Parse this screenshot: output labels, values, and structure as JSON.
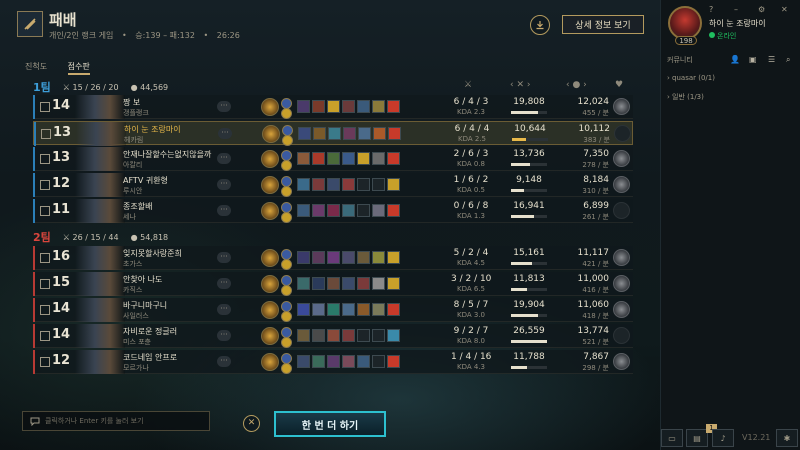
{
  "header": {
    "title": "패배",
    "mode": "개인/2인 랭크 게임",
    "lp": "승:139 – 패:132",
    "duration": "26:26",
    "detail_button": "상세 정보 보기"
  },
  "tabs": [
    {
      "label": "진척도",
      "active": false
    },
    {
      "label": "점수판",
      "active": true
    }
  ],
  "teams": [
    {
      "name": "1팀",
      "kda": "15 / 26 / 20",
      "gold": "44,569",
      "color": "#3d9ed9",
      "players": [
        {
          "level": "14",
          "name": "짱 보",
          "champion": "갱플랭크",
          "kda": "6 / 4 / 3",
          "kda_ratio": "KDA 2.3",
          "damage": "19,808",
          "damage_pct": 0.75,
          "gold": "12,024",
          "gold_per": "455 / 분",
          "self": false,
          "badge": true,
          "items": [
            "#4a3a6a",
            "#7a3a2a",
            "#c8a02a",
            "#6a3a3a",
            "#3a5a7a",
            "#8a7a3a",
            "#c83a2a"
          ]
        },
        {
          "level": "13",
          "name": "하이 눈 조랑마이",
          "champion": "헤카림",
          "kda": "6 / 4 / 4",
          "kda_ratio": "KDA 2.5",
          "damage": "10,644",
          "damage_pct": 0.4,
          "gold": "10,112",
          "gold_per": "383 / 분",
          "self": true,
          "badge": false,
          "items": [
            "#3a4a7a",
            "#7a5a2a",
            "#3a7a8a",
            "#6a3a5a",
            "#4a6a8a",
            "#aa5a2a",
            "#c83a2a"
          ]
        },
        {
          "level": "13",
          "name": "안재나잘할수는없지않을까",
          "champion": "아칼리",
          "kda": "2 / 6 / 3",
          "kda_ratio": "KDA 0.8",
          "damage": "13,736",
          "damage_pct": 0.52,
          "gold": "7,350",
          "gold_per": "278 / 분",
          "self": false,
          "badge": true,
          "items": [
            "#8a5a3a",
            "#aa3a2a",
            "#4a6a3a",
            "#3a5a8a",
            "#c8a02a",
            "#6a6a6a",
            "#c83a2a"
          ]
        },
        {
          "level": "12",
          "name": "AFTV 귀환형",
          "champion": "루시안",
          "kda": "1 / 6 / 2",
          "kda_ratio": "KDA 0.5",
          "damage": "9,148",
          "damage_pct": 0.35,
          "gold": "8,184",
          "gold_per": "310 / 분",
          "self": false,
          "badge": true,
          "items": [
            "#3a6a8a",
            "#7a3a3a",
            "#3a4a6a",
            "#8a3a3a",
            "#1c2428",
            "#1c2428",
            "#c8a02a"
          ]
        },
        {
          "level": "11",
          "name": "종조할배",
          "champion": "세나",
          "kda": "0 / 6 / 8",
          "kda_ratio": "KDA 1.3",
          "damage": "16,941",
          "damage_pct": 0.64,
          "gold": "6,899",
          "gold_per": "261 / 분",
          "self": false,
          "badge": false,
          "items": [
            "#3a5a7a",
            "#6a3a6a",
            "#7a2a4a",
            "#3a6a7a",
            "#1c2428",
            "#6a6a7a",
            "#c83a2a"
          ]
        }
      ]
    },
    {
      "name": "2팀",
      "kda": "26 / 15 / 44",
      "gold": "54,818",
      "color": "#d9453d",
      "players": [
        {
          "level": "16",
          "name": "잊지못할사랑준희",
          "champion": "초가스",
          "kda": "5 / 2 / 4",
          "kda_ratio": "KDA 4.5",
          "damage": "15,161",
          "damage_pct": 0.57,
          "gold": "11,117",
          "gold_per": "421 / 분",
          "self": false,
          "badge": true,
          "items": [
            "#3a3a6a",
            "#5a3a5a",
            "#6a3a7a",
            "#4a4a6a",
            "#6a5a3a",
            "#8a8a3a",
            "#c8a02a"
          ]
        },
        {
          "level": "15",
          "name": "안찾아 나도",
          "champion": "카직스",
          "kda": "3 / 2 / 10",
          "kda_ratio": "KDA 6.5",
          "damage": "11,813",
          "damage_pct": 0.45,
          "gold": "11,000",
          "gold_per": "416 / 분",
          "self": false,
          "badge": true,
          "items": [
            "#3a6a6a",
            "#2a3a5a",
            "#6a4a3a",
            "#3a4a6a",
            "#7a3a3a",
            "#8a8a8a",
            "#c8a02a"
          ]
        },
        {
          "level": "14",
          "name": "바구니마구니",
          "champion": "사일러스",
          "kda": "8 / 5 / 7",
          "kda_ratio": "KDA 3.0",
          "damage": "19,904",
          "damage_pct": 0.75,
          "gold": "11,060",
          "gold_per": "418 / 분",
          "self": false,
          "badge": true,
          "items": [
            "#3a4a9a",
            "#5a6a8a",
            "#2a7a6a",
            "#4a6a8a",
            "#8a5a2a",
            "#7a7a5a",
            "#c83a2a"
          ]
        },
        {
          "level": "14",
          "name": "자비로운 정글러",
          "champion": "미스 포츈",
          "kda": "9 / 2 / 7",
          "kda_ratio": "KDA 8.0",
          "damage": "26,559",
          "damage_pct": 1.0,
          "gold": "13,774",
          "gold_per": "521 / 분",
          "self": false,
          "badge": false,
          "items": [
            "#6a5a3a",
            "#4a4a4a",
            "#8a4a3a",
            "#7a3a3a",
            "#1c2428",
            "#1c2428",
            "#3a8aaa"
          ]
        },
        {
          "level": "12",
          "name": "코드네임 안프로",
          "champion": "모르가나",
          "kda": "1 / 4 / 16",
          "kda_ratio": "KDA 4.3",
          "damage": "11,788",
          "damage_pct": 0.44,
          "gold": "7,867",
          "gold_per": "298 / 분",
          "self": false,
          "badge": true,
          "items": [
            "#3a4a6a",
            "#3a6a5a",
            "#5a3a6a",
            "#7a4a5a",
            "#3a5a7a",
            "#1c2428",
            "#c83a2a"
          ]
        }
      ]
    }
  ],
  "chat": {
    "placeholder": "클릭하거나 Enter 키를 눌러 보기"
  },
  "play_again": "한 번 더 하기",
  "sidebar": {
    "summoner_name": "하이 눈 조랑마이",
    "status": "온라인",
    "level": "198",
    "community_title": "커뮤니티",
    "groups": [
      {
        "label": "quasar (0/1)"
      },
      {
        "label": "일반 (1/3)"
      }
    ],
    "version": "V12.21",
    "notification_count": "1"
  }
}
